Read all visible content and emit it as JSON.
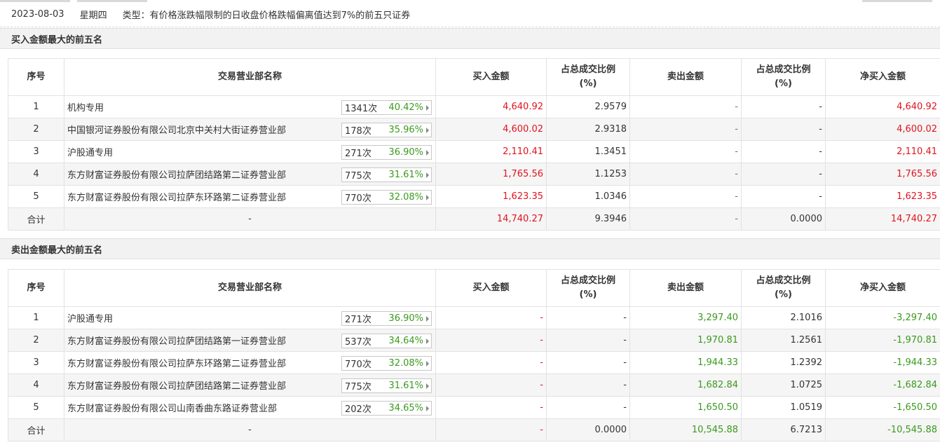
{
  "info": {
    "date": "2023-08-03",
    "weekday": "星期四",
    "type": "类型：有价格涨跌幅限制的日收盘价格跌幅偏离值达到7%的前五只证券"
  },
  "columns": {
    "idx": "序号",
    "name": "交易营业部名称",
    "buy": "买入金额",
    "buy_ratio": "占总成交比例\n(%)",
    "sell": "卖出金额",
    "sell_ratio": "占总成交比例\n(%)",
    "net": "净买入金额"
  },
  "buy_section": {
    "title": "买入金额最大的前五名",
    "rows": [
      {
        "idx": "1",
        "name": "机构专用",
        "count": "1341次",
        "pct": "40.42%",
        "buy": "4,640.92",
        "buy_ratio": "2.9579",
        "sell": "-",
        "sell_ratio": "-",
        "net": "4,640.92"
      },
      {
        "idx": "2",
        "name": "中国银河证券股份有限公司北京中关村大街证券营业部",
        "count": "178次",
        "pct": "35.96%",
        "buy": "4,600.02",
        "buy_ratio": "2.9318",
        "sell": "-",
        "sell_ratio": "-",
        "net": "4,600.02"
      },
      {
        "idx": "3",
        "name": "沪股通专用",
        "count": "271次",
        "pct": "36.90%",
        "buy": "2,110.41",
        "buy_ratio": "1.3451",
        "sell": "-",
        "sell_ratio": "-",
        "net": "2,110.41"
      },
      {
        "idx": "4",
        "name": "东方财富证券股份有限公司拉萨团结路第二证券营业部",
        "count": "775次",
        "pct": "31.61%",
        "buy": "1,765.56",
        "buy_ratio": "1.1253",
        "sell": "-",
        "sell_ratio": "-",
        "net": "1,765.56"
      },
      {
        "idx": "5",
        "name": "东方财富证券股份有限公司拉萨东环路第二证券营业部",
        "count": "770次",
        "pct": "32.08%",
        "buy": "1,623.35",
        "buy_ratio": "1.0346",
        "sell": "-",
        "sell_ratio": "-",
        "net": "1,623.35"
      }
    ],
    "total": {
      "label": "合计",
      "name": "-",
      "buy": "14,740.27",
      "buy_ratio": "9.3946",
      "sell": "-",
      "sell_ratio": "0.0000",
      "net": "14,740.27"
    }
  },
  "sell_section": {
    "title": "卖出金额最大的前五名",
    "rows": [
      {
        "idx": "1",
        "name": "沪股通专用",
        "count": "271次",
        "pct": "36.90%",
        "buy": "-",
        "buy_ratio": "-",
        "sell": "3,297.40",
        "sell_ratio": "2.1016",
        "net": "-3,297.40"
      },
      {
        "idx": "2",
        "name": "东方财富证券股份有限公司拉萨团结路第一证券营业部",
        "count": "537次",
        "pct": "34.64%",
        "buy": "-",
        "buy_ratio": "-",
        "sell": "1,970.81",
        "sell_ratio": "1.2561",
        "net": "-1,970.81"
      },
      {
        "idx": "3",
        "name": "东方财富证券股份有限公司拉萨东环路第二证券营业部",
        "count": "770次",
        "pct": "32.08%",
        "buy": "-",
        "buy_ratio": "-",
        "sell": "1,944.33",
        "sell_ratio": "1.2392",
        "net": "-1,944.33"
      },
      {
        "idx": "4",
        "name": "东方财富证券股份有限公司拉萨团结路第二证券营业部",
        "count": "775次",
        "pct": "31.61%",
        "buy": "-",
        "buy_ratio": "-",
        "sell": "1,682.84",
        "sell_ratio": "1.0725",
        "net": "-1,682.84"
      },
      {
        "idx": "5",
        "name": "东方财富证券股份有限公司山南香曲东路证券营业部",
        "count": "202次",
        "pct": "34.65%",
        "buy": "-",
        "buy_ratio": "-",
        "sell": "1,650.50",
        "sell_ratio": "1.0519",
        "net": "-1,650.50"
      }
    ],
    "total": {
      "label": "合计",
      "name": "-",
      "buy": "-",
      "buy_ratio": "0.0000",
      "sell": "10,545.88",
      "sell_ratio": "6.7213",
      "net": "-10,545.88"
    }
  },
  "colors": {
    "up": "#e1141e",
    "down": "#3a9a1e",
    "header_bg": "#f2f2f2",
    "stripe_bg": "#f5f5f5"
  }
}
